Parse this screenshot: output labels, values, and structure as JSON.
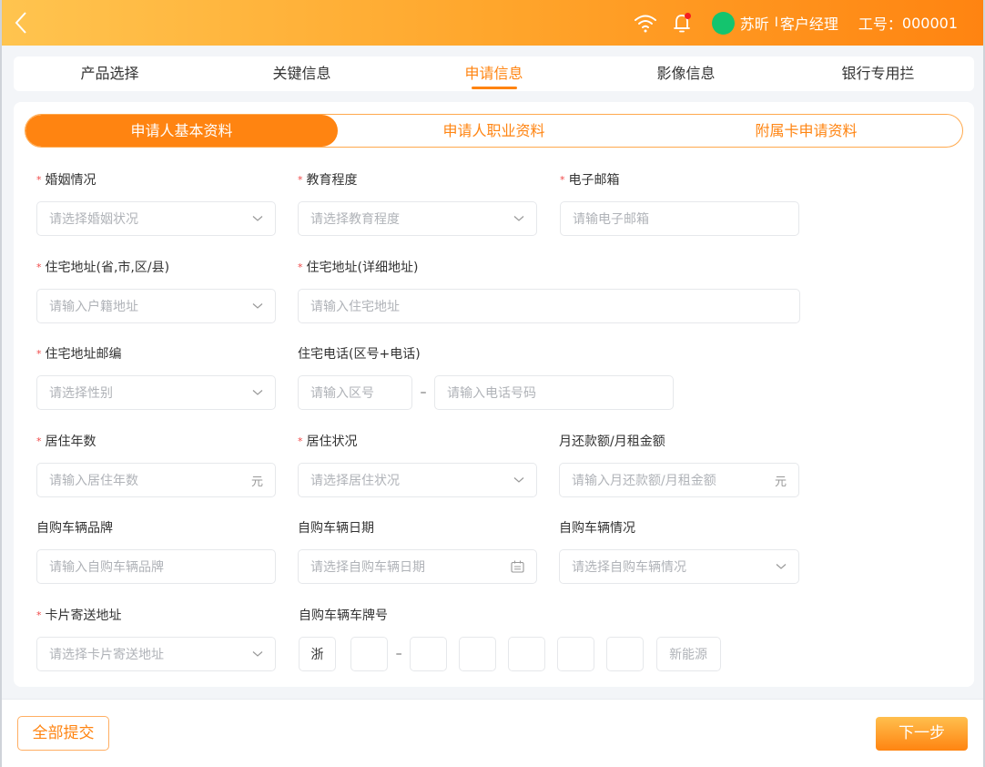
{
  "header": {
    "user_name": "苏昕",
    "separator": "I",
    "user_role": "客户经理",
    "employee_id_label": "工号：",
    "employee_id": "000001",
    "icons": [
      "back-arrow-icon",
      "wifi-icon",
      "bell-icon",
      "avatar"
    ]
  },
  "top_tabs": [
    {
      "label": "产品选择",
      "active": false
    },
    {
      "label": "关键信息",
      "active": false
    },
    {
      "label": "申请信息",
      "active": true
    },
    {
      "label": "影像信息",
      "active": false
    },
    {
      "label": "银行专用拦",
      "active": false
    }
  ],
  "segments": [
    {
      "label": "申请人基本资料",
      "active": true
    },
    {
      "label": "申请人职业资料",
      "active": false
    },
    {
      "label": "附属卡申请资料",
      "active": false
    }
  ],
  "form": {
    "marital": {
      "label": "婚姻情况",
      "required": true,
      "placeholder": "请选择婚姻状况",
      "type": "select"
    },
    "education": {
      "label": "教育程度",
      "required": true,
      "placeholder": "请选择教育程度",
      "type": "select"
    },
    "email": {
      "label": "电子邮箱",
      "required": true,
      "placeholder": "请输电子邮箱",
      "type": "text"
    },
    "address_region": {
      "label": "住宅地址(省,市,区/县)",
      "required": true,
      "placeholder": "请输入户籍地址",
      "type": "select"
    },
    "address_detail": {
      "label": "住宅地址(详细地址)",
      "required": true,
      "placeholder": "请输入住宅地址",
      "type": "text"
    },
    "postcode": {
      "label": "住宅地址邮编",
      "required": true,
      "placeholder": "请选择性别",
      "type": "select"
    },
    "home_phone": {
      "label": "住宅电话(区号+电话)",
      "required": false,
      "area_placeholder": "请输入区号",
      "separator": "–",
      "number_placeholder": "请输入电话号码"
    },
    "residence_years": {
      "label": "居住年数",
      "required": true,
      "placeholder": "请输入居住年数",
      "suffix": "元",
      "type": "text"
    },
    "residence_status": {
      "label": "居住状况",
      "required": true,
      "placeholder": "请选择居住状况",
      "type": "select"
    },
    "monthly_payment": {
      "label": "月还款额/月租金额",
      "required": false,
      "placeholder": "请输入月还款额/月租金额",
      "suffix": "元",
      "type": "text"
    },
    "car_brand": {
      "label": "自购车辆品牌",
      "required": false,
      "placeholder": "请输入自购车辆品牌",
      "type": "text"
    },
    "car_date": {
      "label": "自购车辆日期",
      "required": false,
      "placeholder": "请选择自购车辆日期",
      "type": "date"
    },
    "car_status": {
      "label": "自购车辆情况",
      "required": false,
      "placeholder": "请选择自购车辆情况",
      "type": "select"
    },
    "card_address": {
      "label": "卡片寄送地址",
      "required": true,
      "placeholder": "请选择卡片寄送地址",
      "type": "select"
    },
    "plate": {
      "label": "自购车辆车牌号",
      "required": false,
      "province": "浙",
      "separator": "–",
      "chars": [
        "",
        "",
        "",
        "",
        "",
        ""
      ],
      "new_energy": "新能源"
    }
  },
  "required_mark": "*",
  "footer": {
    "submit_all": "全部提交",
    "next": "下一步"
  }
}
